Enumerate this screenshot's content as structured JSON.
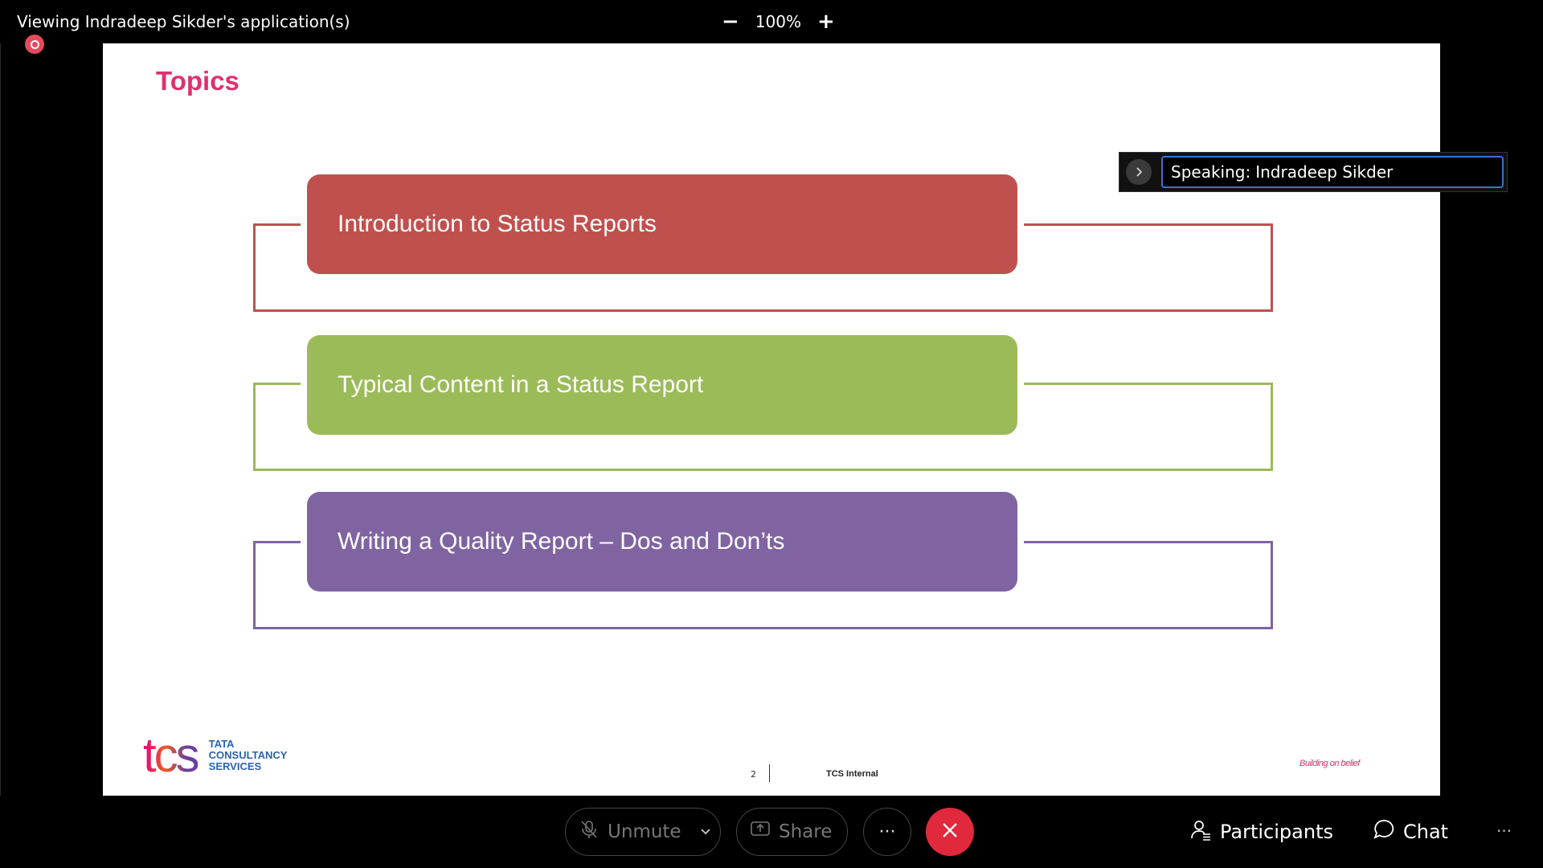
{
  "topbar": {
    "title": "Viewing Indradeep Sikder's application(s)",
    "zoom_minus": "−",
    "zoom_level": "100%",
    "zoom_plus": "+"
  },
  "slide": {
    "title": "Topics",
    "items": [
      {
        "label": "Introduction to Status Reports",
        "color": "#c0504d"
      },
      {
        "label": "Typical Content in a Status Report",
        "color": "#9bbb59"
      },
      {
        "label": "Writing a Quality Report – Dos and Don’ts",
        "color": "#8064a2"
      }
    ],
    "logo_mark": "tcs",
    "logo_line1": "TATA",
    "logo_line2": "CONSULTANCY",
    "logo_line3": "SERVICES",
    "page_number": "2",
    "classification": "TCS Internal",
    "tagline": "Building on belief"
  },
  "speaking": {
    "prefix": "Speaking:",
    "name": "Indradeep Sikder"
  },
  "controls": {
    "unmute": "Unmute",
    "share": "Share",
    "more": "···",
    "participants": "Participants",
    "chat": "Chat",
    "corner_more": "···"
  }
}
